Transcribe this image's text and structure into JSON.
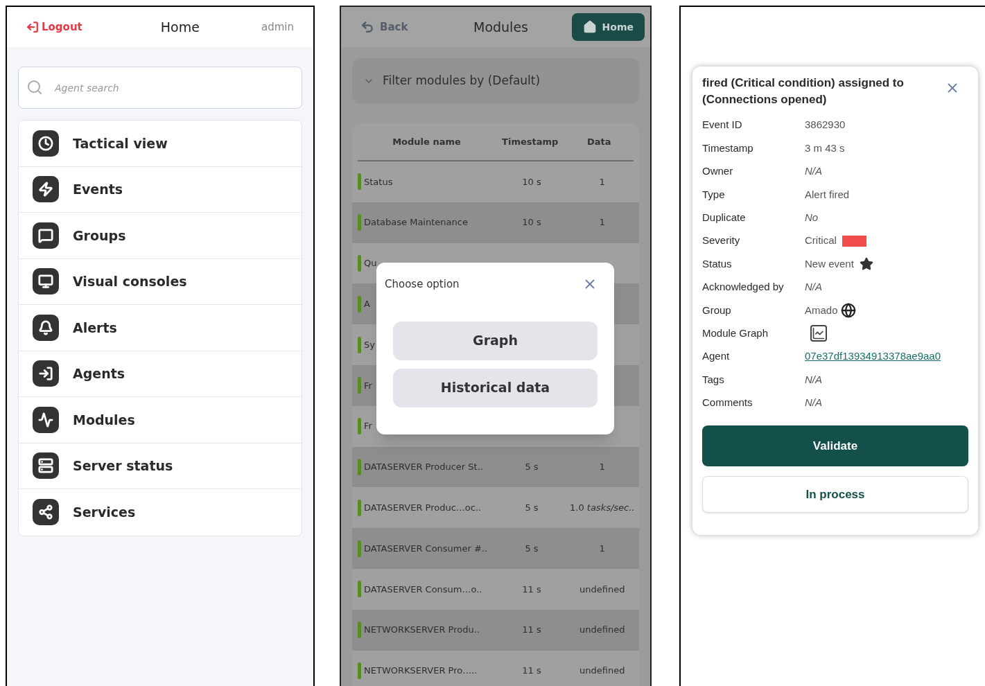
{
  "home_screen": {
    "logout": "Logout",
    "title": "Home",
    "user": "admin",
    "search": {
      "placeholder": "Agent search"
    },
    "menu": [
      {
        "label": "Tactical view",
        "kind": "tactical"
      },
      {
        "label": "Events",
        "kind": "events"
      },
      {
        "label": "Groups",
        "kind": "groups"
      },
      {
        "label": "Visual consoles",
        "kind": "consoles"
      },
      {
        "label": "Alerts",
        "kind": "alerts"
      },
      {
        "label": "Agents",
        "kind": "agents"
      },
      {
        "label": "Modules",
        "kind": "modules"
      },
      {
        "label": "Server status",
        "kind": "server"
      },
      {
        "label": "Services",
        "kind": "services"
      }
    ]
  },
  "modules_screen": {
    "back": "Back",
    "title": "Modules",
    "home": "Home",
    "filter": "Filter modules by (Default)",
    "table": {
      "columns": [
        "Module name",
        "Timestamp",
        "Data"
      ],
      "rows": [
        {
          "name": "Status",
          "timestamp": "10 s",
          "data": "1"
        },
        {
          "name": "Database Maintenance",
          "timestamp": "10 s",
          "data": "1"
        },
        {
          "name": "Qu"
        },
        {
          "name": "A"
        },
        {
          "name": "Sy"
        },
        {
          "name": "Fr"
        },
        {
          "name": "Fr"
        },
        {
          "name": "DATASERVER Producer St..",
          "timestamp": "5 s",
          "data": "1"
        },
        {
          "name": "DATASERVER Produc…oc..",
          "timestamp": "5 s",
          "data": "1.0 *tasks/sec..*"
        },
        {
          "name": "DATASERVER Consumer #..",
          "timestamp": "5 s",
          "data": "1"
        },
        {
          "name": "DATASERVER Consum…o..",
          "timestamp": "11 s",
          "data": "undefined"
        },
        {
          "name": "NETWORKSERVER Produ..",
          "timestamp": "11 s",
          "data": "undefined"
        },
        {
          "name": "NETWORKSERVER Pro…..",
          "timestamp": "11 s",
          "data": "undefined"
        }
      ]
    },
    "dialog": {
      "title": "Choose option",
      "options": [
        "Graph",
        "Historical data"
      ]
    }
  },
  "event_screen": {
    "dialog": {
      "title": "fired (Critical condition) assigned to (Connections opened)",
      "fields": [
        {
          "label": "Event ID",
          "value": "3862930",
          "kind": "text"
        },
        {
          "label": "Timestamp",
          "value": "3 m 43 s",
          "kind": "text"
        },
        {
          "label": "Owner",
          "value": "N/A",
          "kind": "italic"
        },
        {
          "label": "Type",
          "value": "Alert fired",
          "kind": "text"
        },
        {
          "label": "Duplicate",
          "value": "No",
          "kind": "italic"
        },
        {
          "label": "Severity",
          "value": "Critical",
          "kind": "severity",
          "color": "#f24b4b"
        },
        {
          "label": "Status",
          "value": "New event",
          "kind": "status"
        },
        {
          "label": "Acknowledged by",
          "value": "N/A",
          "kind": "italic"
        },
        {
          "label": "Group",
          "value": "Amado",
          "kind": "group"
        },
        {
          "label": "Module Graph",
          "kind": "graph"
        },
        {
          "label": "Agent",
          "value": "07e37df13934913378ae9aa0",
          "kind": "link"
        },
        {
          "label": "Tags",
          "value": "N/A",
          "kind": "italic"
        },
        {
          "label": "Comments",
          "value": "N/A",
          "kind": "italic"
        }
      ],
      "buttons": [
        {
          "label": "Validate",
          "kind": "primary"
        },
        {
          "label": "In process",
          "kind": "secondary"
        }
      ]
    }
  }
}
